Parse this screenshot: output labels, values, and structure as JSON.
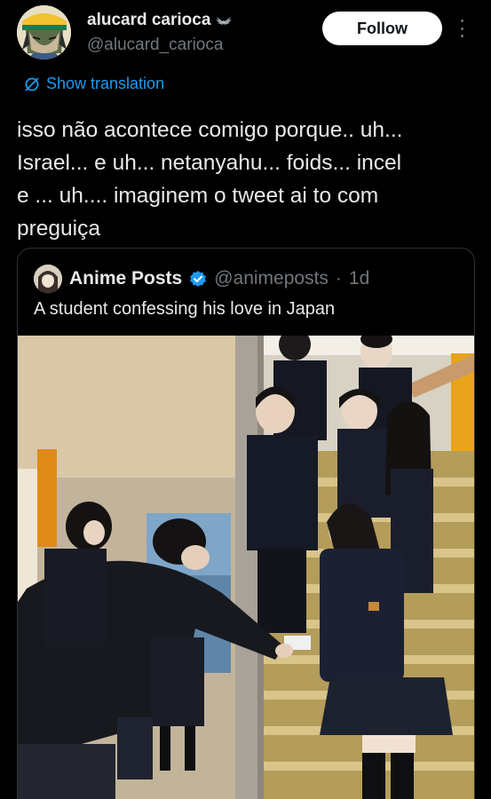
{
  "author": {
    "display_name": "alucard carioca",
    "handle": "@alucard_carioca",
    "avatar_icon": "anime-avatar"
  },
  "follow_label": "Follow",
  "translate_label": "Show translation",
  "tweet_text": "isso não acontece comigo porque..  uh...\nIsrael... e uh... netanyahu... foids... incel\ne ... uh.... imaginem o tweet ai to com\npreguiça",
  "quote": {
    "display_name": "Anime Posts",
    "handle": "@animeposts",
    "separator": "·",
    "time": "1d",
    "text": "A student confessing his love in Japan"
  },
  "colors": {
    "background": "#000000",
    "text": "#e7e9ea",
    "muted": "#71767b",
    "link": "#1d9bf0",
    "border": "#2f3336"
  }
}
